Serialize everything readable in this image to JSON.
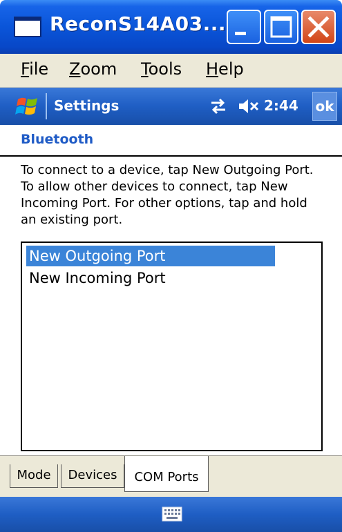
{
  "window": {
    "title": "ReconS14A03..."
  },
  "menubar": {
    "items": [
      {
        "label": "File",
        "accel": "F",
        "rest": "ile"
      },
      {
        "label": "Zoom",
        "accel": "Z",
        "rest": "oom"
      },
      {
        "label": "Tools",
        "accel": "T",
        "rest": "ools"
      },
      {
        "label": "Help",
        "accel": "H",
        "rest": "elp"
      }
    ]
  },
  "navbar": {
    "title": "Settings",
    "clock": "2:44",
    "ok_label": "ok"
  },
  "page": {
    "header": "Bluetooth",
    "instructions": "To connect to a device, tap New Outgoing Port. To allow other devices to connect, tap New Incoming Port. For other options, tap and hold an existing port."
  },
  "ports": {
    "items": [
      {
        "label": "New Outgoing Port",
        "selected": true
      },
      {
        "label": "New Incoming Port",
        "selected": false
      }
    ]
  },
  "tabs": [
    {
      "label": "Mode",
      "active": false
    },
    {
      "label": "Devices",
      "active": false
    },
    {
      "label": "COM Ports",
      "active": true
    }
  ],
  "colors": {
    "title_bar": "#0a55d9",
    "nav_bar": "#1f5ec4",
    "selection": "#3b84d8",
    "header_text": "#1f5bc6",
    "menu_bg": "#ece9d8"
  },
  "icons": {
    "window": "window-icon",
    "minimize": "minimize-icon",
    "maximize": "maximize-icon",
    "close": "close-icon",
    "start": "windows-flag-icon",
    "connectivity": "connectivity-arrows-icon",
    "volume": "volume-muted-icon",
    "keyboard": "keyboard-icon"
  }
}
